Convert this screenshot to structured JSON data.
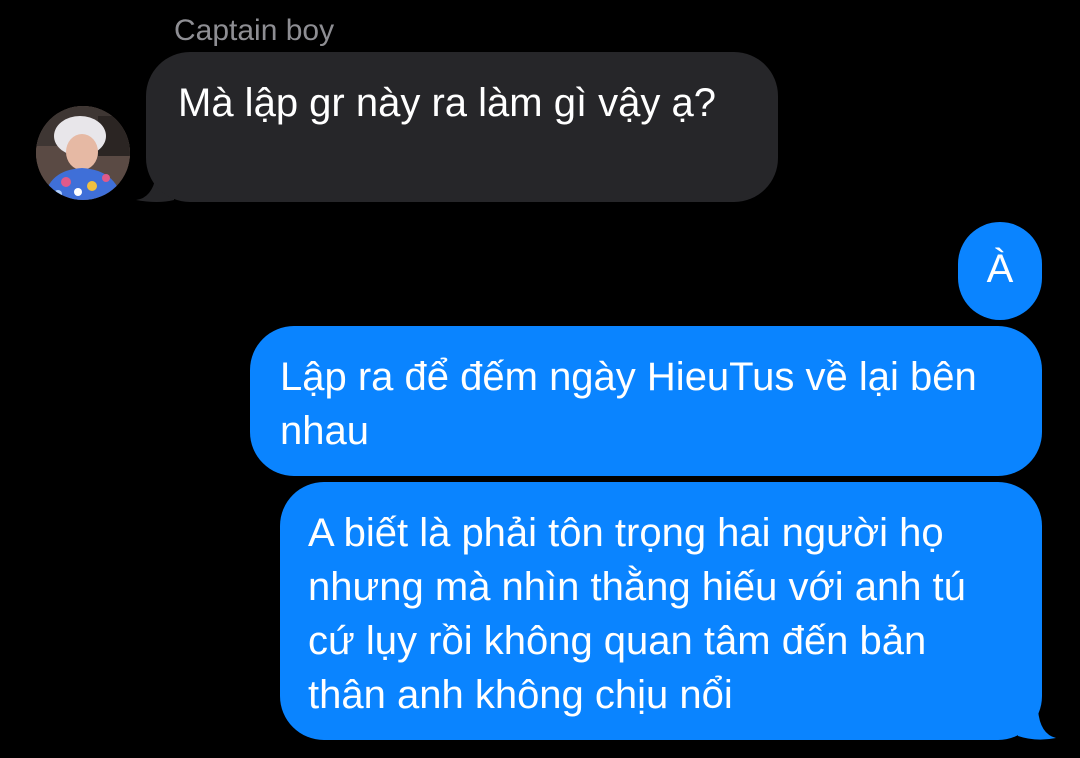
{
  "conversation": {
    "incoming": {
      "sender_name": "Captain boy",
      "avatar_icon": "user-avatar-photo",
      "messages": [
        {
          "text": "Mà lập gr này ra làm gì vậy ạ?"
        }
      ]
    },
    "outgoing": {
      "messages": [
        {
          "text": "À"
        },
        {
          "text": "Lập ra để đếm ngày HieuTus về lại bên nhau"
        },
        {
          "text": "A biết là phải tôn trọng hai người họ nhưng mà nhìn thằng hiếu với anh tú cứ lụy rồi không quan tâm đến bản thân anh không chịu nổi"
        }
      ]
    }
  },
  "colors": {
    "background": "#000000",
    "incoming_bubble": "#262629",
    "outgoing_bubble": "#0a84ff",
    "sender_name": "#8e8e93",
    "text": "#ffffff"
  }
}
